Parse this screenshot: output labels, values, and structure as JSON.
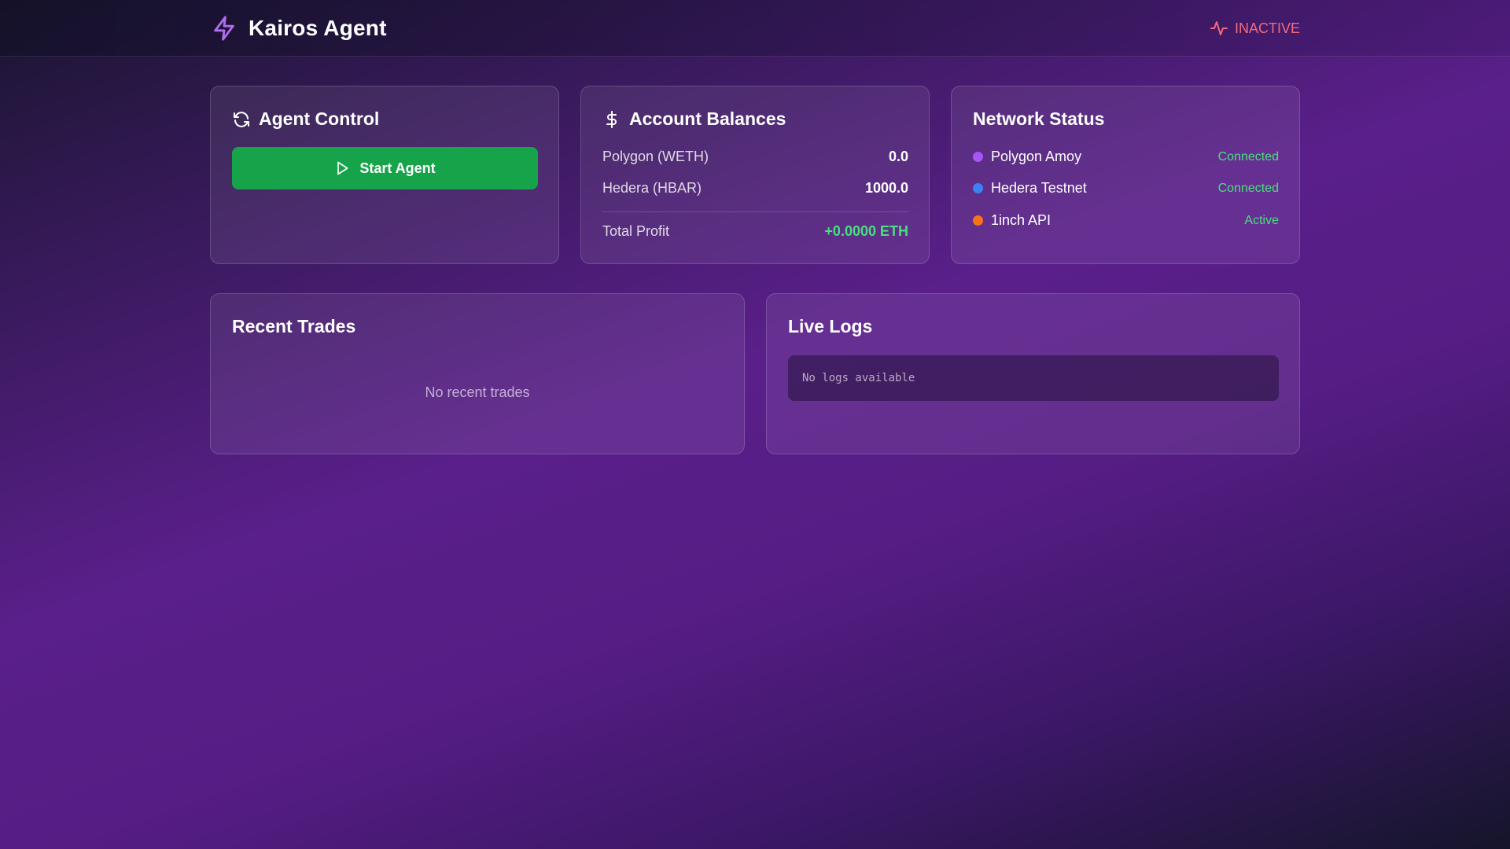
{
  "header": {
    "title": "Kairos Agent",
    "logo_icon": "lightning-bolt-icon",
    "status_label": "INACTIVE",
    "status_icon": "activity-icon",
    "status_color": "#f26b7a"
  },
  "agent_control": {
    "title": "Agent Control",
    "icon": "refresh-icon",
    "start_button_label": "Start Agent",
    "button_color": "#16a34a"
  },
  "balances": {
    "title": "Account Balances",
    "icon": "dollar-icon",
    "rows": [
      {
        "label": "Polygon (WETH)",
        "value": "0.0"
      },
      {
        "label": "Hedera (HBAR)",
        "value": "1000.0"
      }
    ],
    "profit_label": "Total Profit",
    "profit_value": "+0.0000 ETH",
    "profit_color": "#4ade80"
  },
  "network": {
    "title": "Network Status",
    "items": [
      {
        "name": "Polygon Amoy",
        "status": "Connected",
        "color": "#a855f7"
      },
      {
        "name": "Hedera Testnet",
        "status": "Connected",
        "color": "#3b82f6"
      },
      {
        "name": "1inch API",
        "status": "Active",
        "color": "#f97316"
      }
    ]
  },
  "trades": {
    "title": "Recent Trades",
    "empty_text": "No recent trades"
  },
  "logs": {
    "title": "Live Logs",
    "empty_text": "No logs available"
  }
}
